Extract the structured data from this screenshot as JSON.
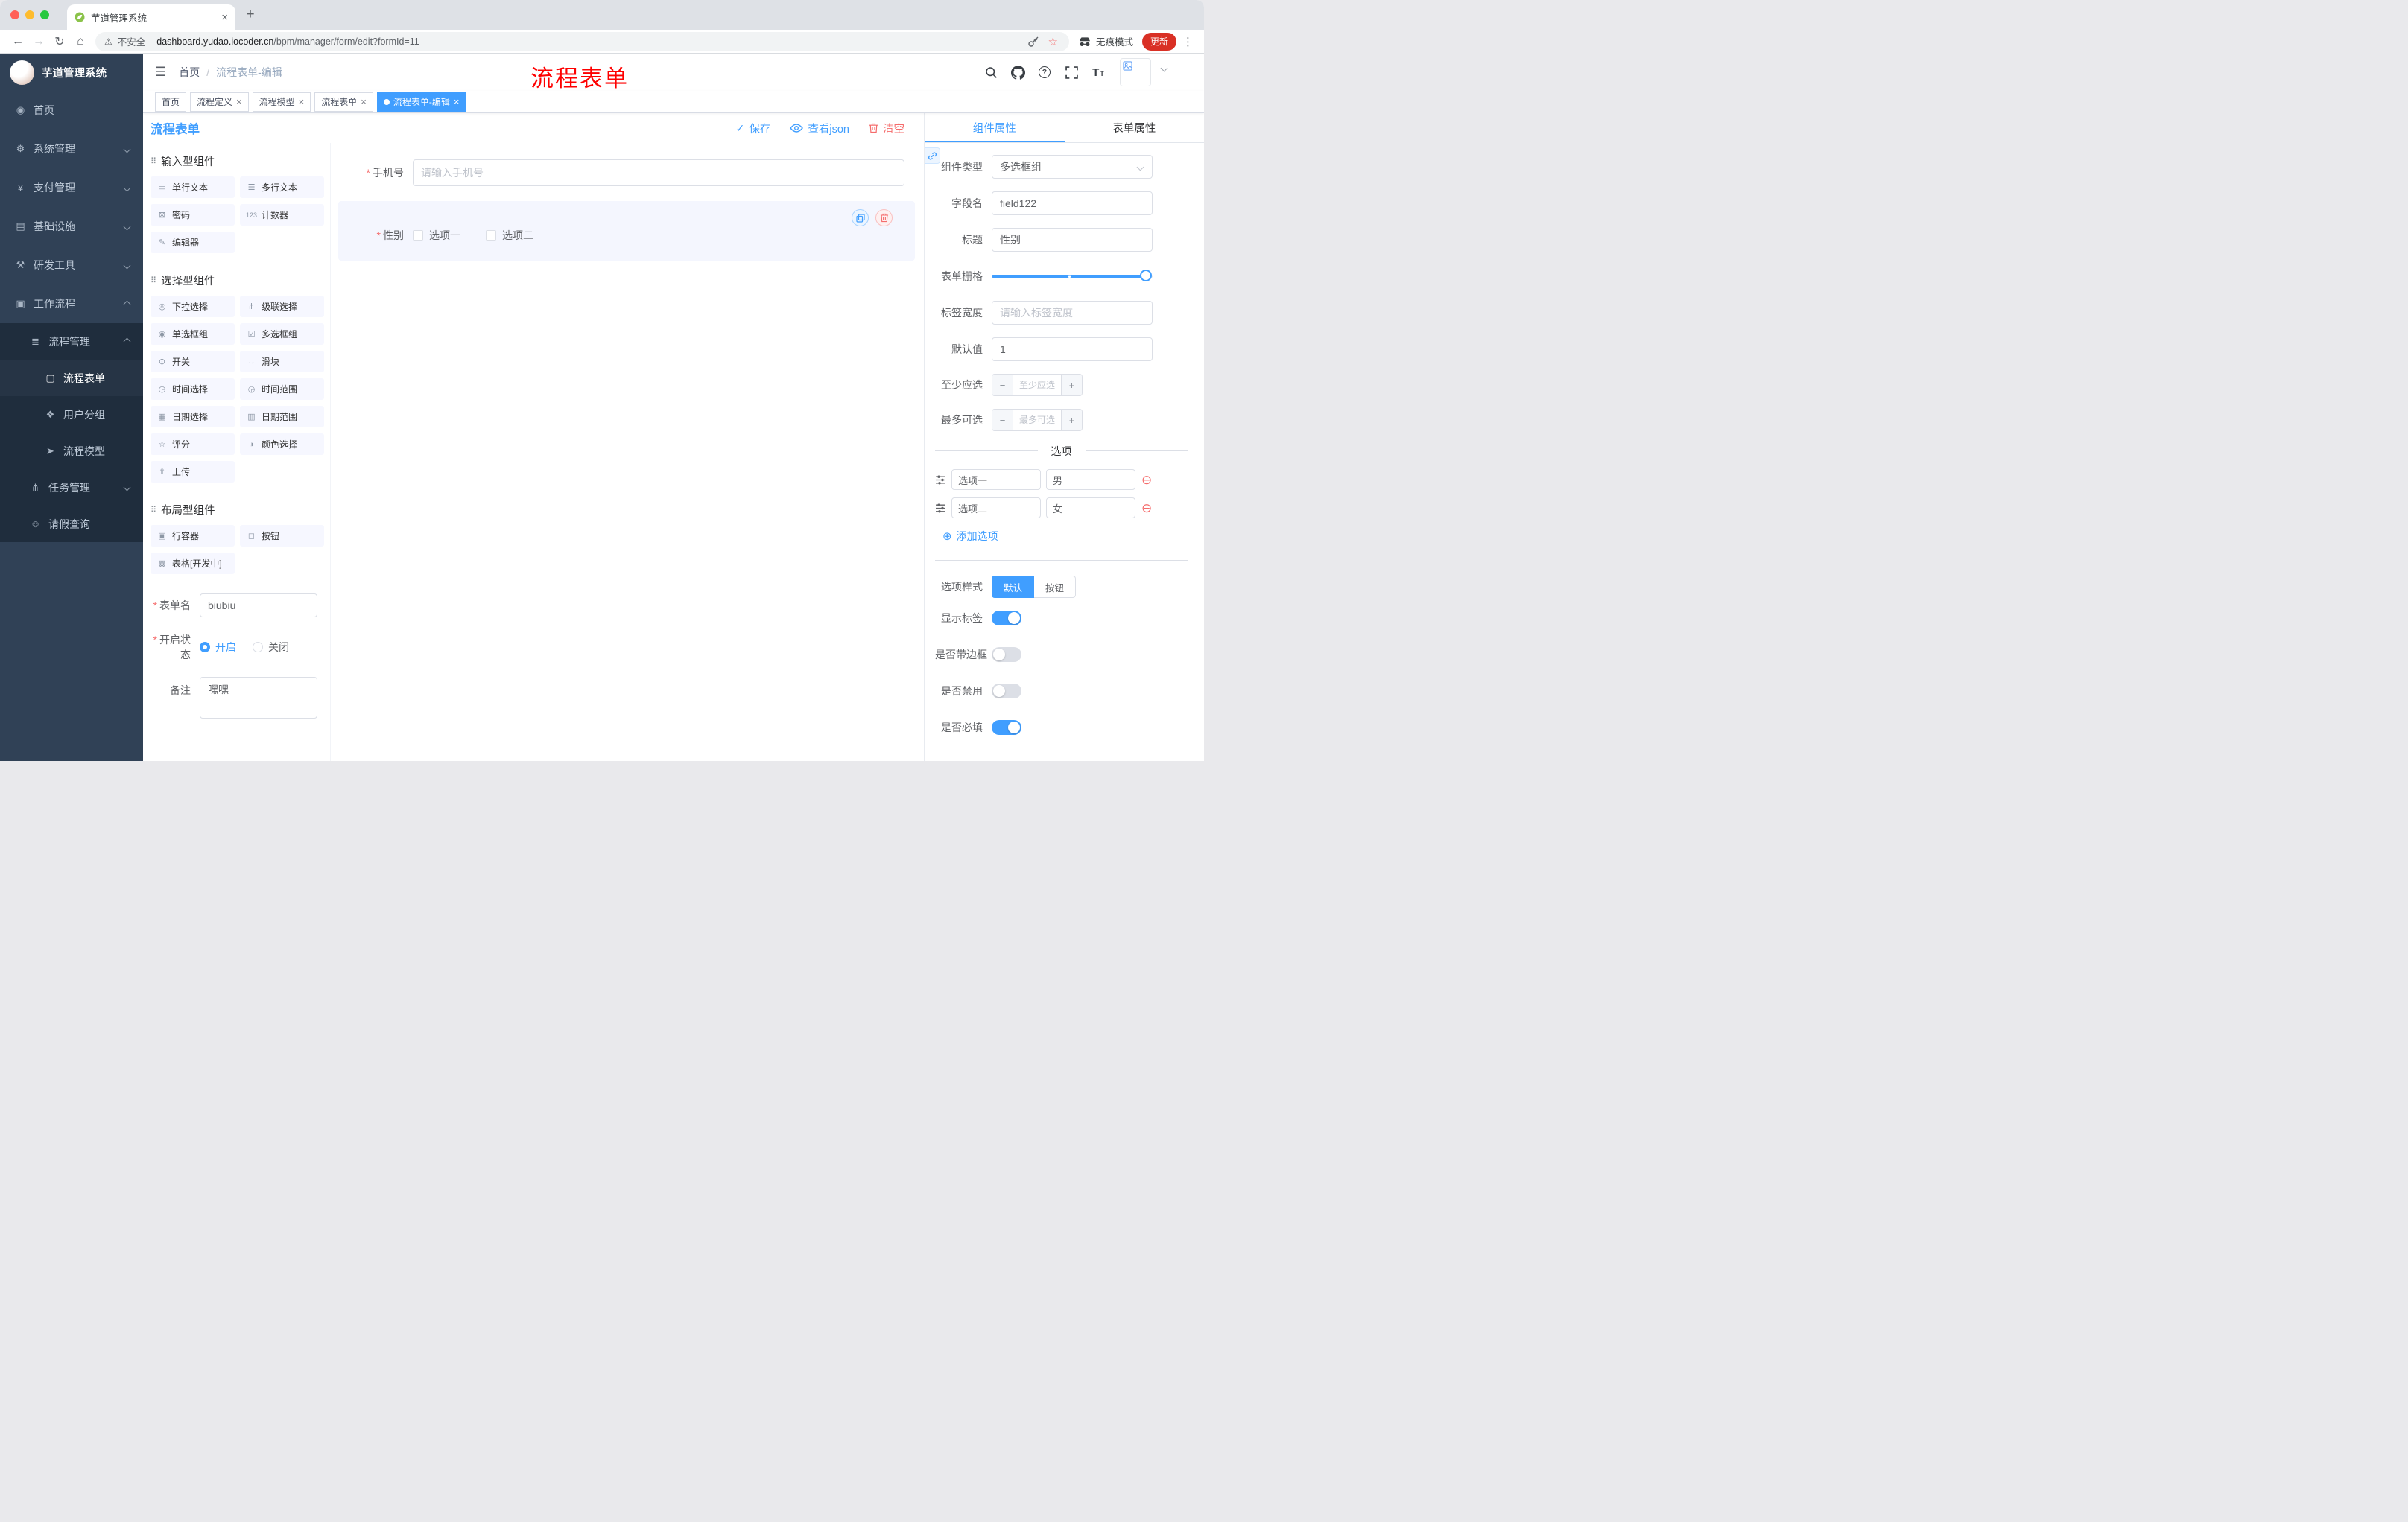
{
  "colors": {
    "primary": "#409eff",
    "danger": "#f56c6c",
    "annotation_red": "#fe0000",
    "sidebar_bg": "#304156",
    "submenu_bg": "#1f2d3d",
    "update_pill": "#d93025"
  },
  "icons": {
    "asterisk": "*",
    "close": "×",
    "plus": "+",
    "minus": "−",
    "kebab": "⋮",
    "back_arrow": "←",
    "forward_arrow": "→",
    "reload": "↻",
    "home": "⌂",
    "warning": "⚠",
    "star": "☆",
    "hamburger": "☰",
    "breadcrumb_sep": "/",
    "check": "✓",
    "question": "?",
    "font_size": "T",
    "add_circle": "⊕",
    "remove_circle": "⊖",
    "section_drag": "⠿",
    "dashboard": "◉",
    "gear": "⚙",
    "yen": "¥",
    "monitor": "▤",
    "hammer": "⚒",
    "briefcase": "▣",
    "list": "≣",
    "document": "▢",
    "users": "❖",
    "send": "➤",
    "tasks": "⋔",
    "person": "☺",
    "comp_input": "▭",
    "comp_textarea": "☰",
    "comp_password": "⊠",
    "comp_counter": "123",
    "comp_editor": "✎",
    "comp_select": "◎",
    "comp_cascader": "⋔",
    "comp_radio": "◉",
    "comp_checkbox": "☑",
    "comp_switch": "⊙",
    "comp_slider": "↔",
    "comp_time": "◷",
    "comp_time_range": "◶",
    "comp_date": "▦",
    "comp_date_range": "▥",
    "comp_rate": "☆",
    "comp_color": "◑",
    "comp_upload": "⇧",
    "comp_row": "▣",
    "comp_button": "◻",
    "comp_table": "▩"
  },
  "browser": {
    "tab_title": "芋道管理系统",
    "security_label": "不安全",
    "url_host": "dashboard.yudao.iocoder.cn",
    "url_path": "/bpm/manager/form/edit?formId=11",
    "incognito_label": "无痕模式",
    "update_label": "更新"
  },
  "sidebar": {
    "logo_title": "芋道管理系统",
    "menu": [
      {
        "label": "首页"
      },
      {
        "label": "系统管理"
      },
      {
        "label": "支付管理"
      },
      {
        "label": "基础设施"
      },
      {
        "label": "研发工具"
      },
      {
        "label": "工作流程"
      },
      {
        "label": "流程管理"
      },
      {
        "label": "流程表单"
      },
      {
        "label": "用户分组"
      },
      {
        "label": "流程模型"
      },
      {
        "label": "任务管理"
      },
      {
        "label": "请假查询"
      }
    ]
  },
  "header": {
    "breadcrumb_home": "首页",
    "breadcrumb_current": "流程表单-编辑",
    "annotation": "流程表单"
  },
  "tags": [
    {
      "label": "首页"
    },
    {
      "label": "流程定义"
    },
    {
      "label": "流程模型"
    },
    {
      "label": "流程表单"
    },
    {
      "label": "流程表单-编辑"
    }
  ],
  "designer": {
    "title": "流程表单",
    "save_label": "保存",
    "view_json_label": "查看json",
    "clear_label": "清空",
    "palette": {
      "section_input": "输入型组件",
      "input_items": [
        "单行文本",
        "多行文本",
        "密码",
        "计数器",
        "编辑器"
      ],
      "section_select": "选择型组件",
      "select_items": [
        "下拉选择",
        "级联选择",
        "单选框组",
        "多选框组",
        "开关",
        "滑块",
        "时间选择",
        "时间范围",
        "日期选择",
        "日期范围",
        "评分",
        "颜色选择",
        "上传"
      ],
      "section_layout": "布局型组件",
      "layout_items": [
        "行容器",
        "按钮",
        "表格[开发中]"
      ]
    },
    "form_meta": {
      "name_label": "表单名",
      "name_value": "biubiu",
      "status_label": "开启状态",
      "status_on": "开启",
      "status_off": "关闭",
      "remark_label": "备注",
      "remark_value": "嘿嘿"
    },
    "canvas": {
      "phone_label": "手机号",
      "phone_placeholder": "请输入手机号",
      "gender_label": "性别",
      "gender_option1": "选项一",
      "gender_option2": "选项二"
    }
  },
  "properties": {
    "tab_component": "组件属性",
    "tab_form": "表单属性",
    "type_label": "组件类型",
    "type_value": "多选框组",
    "field_label": "字段名",
    "field_value": "field122",
    "title_label": "标题",
    "title_value": "性别",
    "grid_label": "表单栅格",
    "label_width_label": "标签宽度",
    "label_width_placeholder": "请输入标签宽度",
    "default_label": "默认值",
    "default_value": "1",
    "min_label": "至少应选",
    "min_placeholder": "至少应选",
    "max_label": "最多可选",
    "max_placeholder": "最多可选",
    "options_title": "选项",
    "options": [
      {
        "label": "选项一",
        "value": "男"
      },
      {
        "label": "选项二",
        "value": "女"
      }
    ],
    "add_option_label": "添加选项",
    "style_label": "选项样式",
    "style_default": "默认",
    "style_button": "按钮",
    "show_label_label": "显示标签",
    "border_label": "是否带边框",
    "disabled_label": "是否禁用",
    "required_label": "是否必填"
  }
}
